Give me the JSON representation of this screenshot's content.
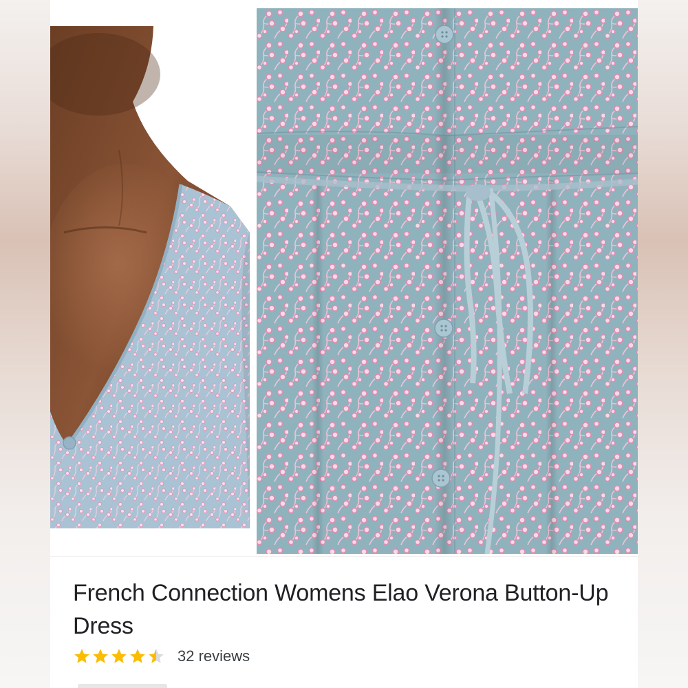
{
  "product": {
    "title": "French Connection Womens Elao Verona Button-Up Dress",
    "rating": 4.5,
    "rating_max": 5,
    "reviews_label": "32 reviews"
  },
  "images": {
    "left": "model-neckline-photo",
    "right": "dress-waist-tie-closeup-photo"
  },
  "colors": {
    "fabric_base": "#8fb3bd",
    "fabric_flower": "#f2c7da",
    "fabric_flower_ring": "#d98fb3",
    "star": "#fbbc04",
    "star_empty": "#dadce0",
    "title_text": "#202124"
  }
}
